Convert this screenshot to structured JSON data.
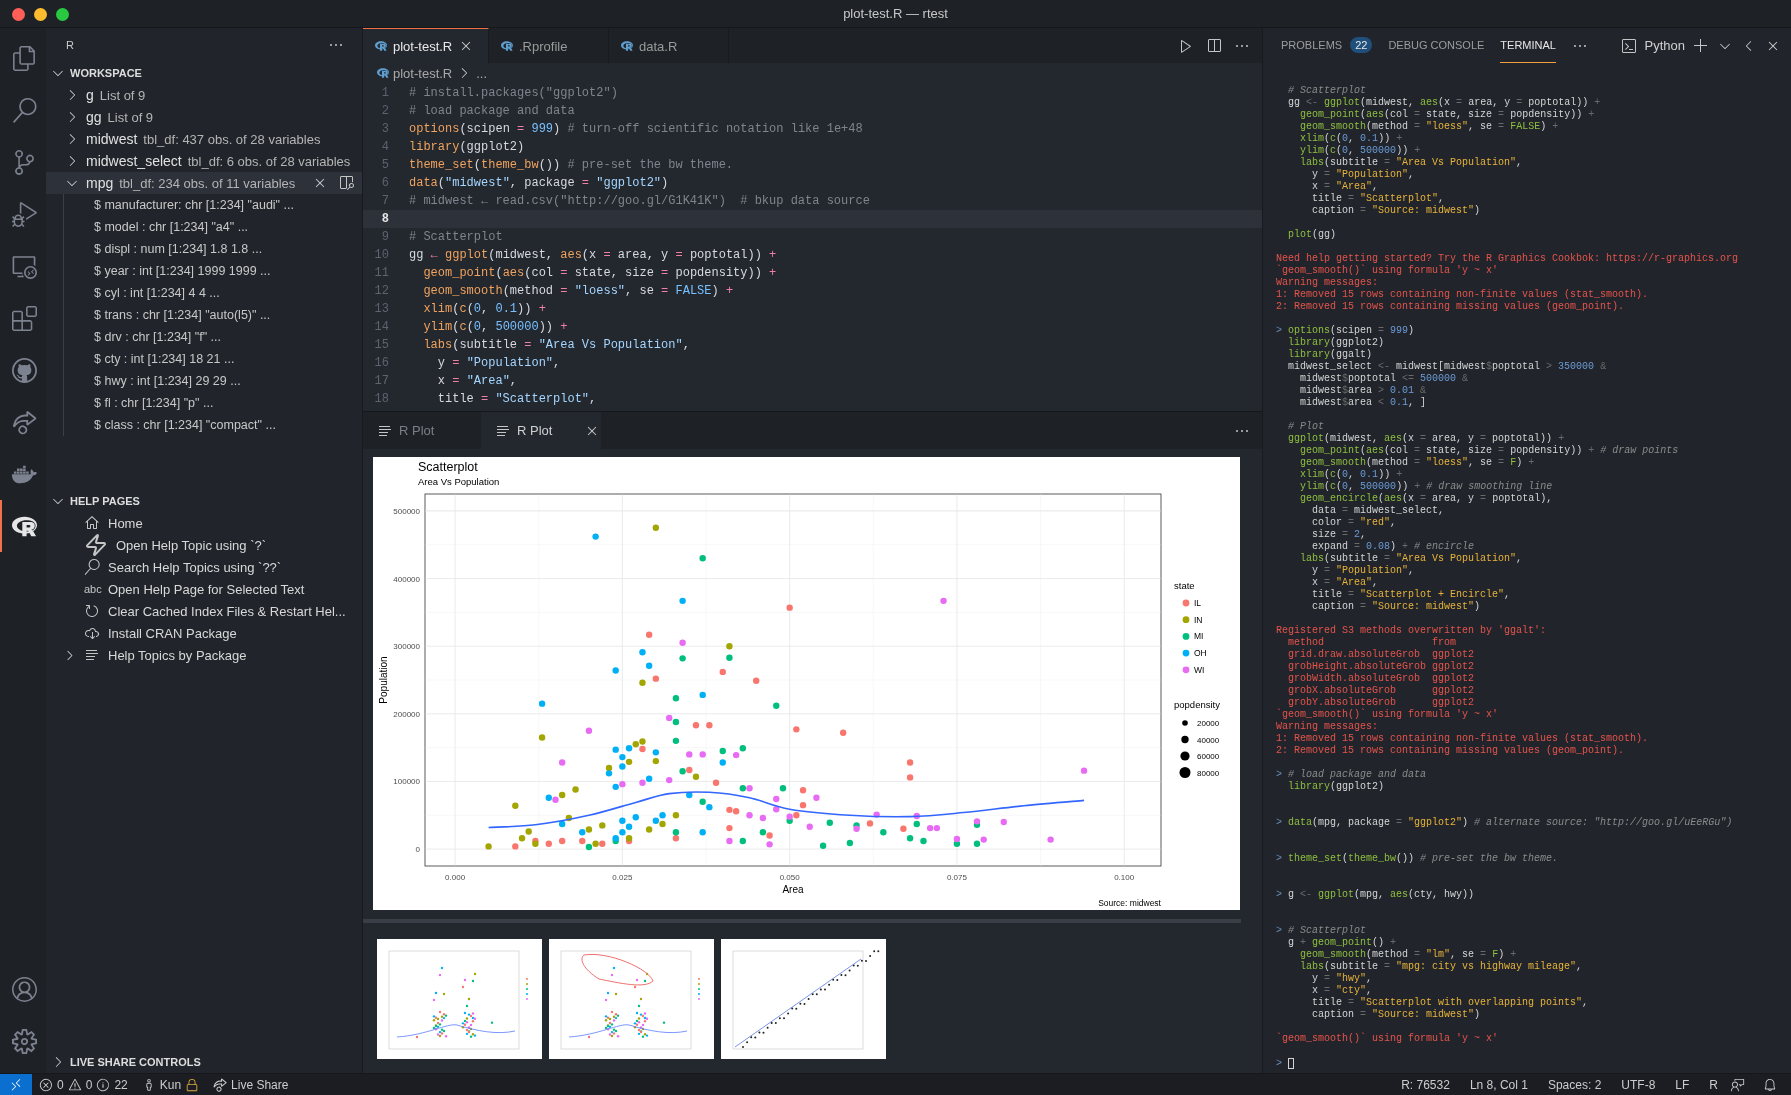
{
  "window": {
    "title": "plot-test.R — rtest"
  },
  "activity_bar": {
    "top": [
      {
        "kind": "files",
        "selected": false
      },
      {
        "kind": "search",
        "selected": false
      },
      {
        "kind": "source-control",
        "selected": false
      },
      {
        "kind": "run-debug",
        "selected": false
      },
      {
        "kind": "remote",
        "selected": false
      },
      {
        "kind": "extensions",
        "selected": false
      },
      {
        "kind": "github",
        "selected": false
      },
      {
        "kind": "live-share",
        "selected": false
      },
      {
        "kind": "docker",
        "selected": false
      },
      {
        "kind": "r",
        "selected": true
      }
    ],
    "bottom": [
      {
        "kind": "account",
        "selected": false
      },
      {
        "kind": "settings",
        "selected": false
      }
    ]
  },
  "sidebar": {
    "title": "R",
    "workspace": {
      "title": "WORKSPACE",
      "expanded": true,
      "items": [
        {
          "name": "g",
          "detail": "List of 9",
          "expanded": false,
          "selected": false
        },
        {
          "name": "gg",
          "detail": "List of 9",
          "expanded": false,
          "selected": false
        },
        {
          "name": "midwest",
          "detail": "tbl_df: 437 obs. of 28 variables",
          "expanded": false,
          "selected": false
        },
        {
          "name": "midwest_select",
          "detail": "tbl_df: 6 obs. of 28 variables",
          "expanded": false,
          "selected": false
        },
        {
          "name": "mpg",
          "detail": "tbl_df: 234 obs. of 11 variables",
          "expanded": true,
          "selected": true,
          "children": [
            {
              "text": "$ manufacturer: chr [1:234] \"audi\" ..."
            },
            {
              "text": "$ model : chr [1:234] \"a4\" ..."
            },
            {
              "text": "$ displ : num [1:234] 1.8 1.8 ..."
            },
            {
              "text": "$ year : int [1:234] 1999 1999 ..."
            },
            {
              "text": "$ cyl : int [1:234] 4 4 ..."
            },
            {
              "text": "$ trans : chr [1:234] \"auto(l5)\" ..."
            },
            {
              "text": "$ drv : chr [1:234] \"f\" ..."
            },
            {
              "text": "$ cty : int [1:234] 18 21 ..."
            },
            {
              "text": "$ hwy : int [1:234] 29 29 ..."
            },
            {
              "text": "$ fl : chr [1:234] \"p\" ..."
            },
            {
              "text": "$ class : chr [1:234] \"compact\" ..."
            }
          ]
        }
      ]
    },
    "help_pages": {
      "title": "HELP PAGES",
      "expanded": true,
      "items": [
        {
          "kind": "home",
          "label": "Home"
        },
        {
          "kind": "zap",
          "label": "Open Help Topic using `?`"
        },
        {
          "kind": "search",
          "label": "Search Help Topics using `??`"
        },
        {
          "kind": "text",
          "icon_text": "abc",
          "label": "Open Help Page for Selected Text"
        },
        {
          "kind": "refresh",
          "label": "Clear Cached Index Files & Restart Hel..."
        },
        {
          "kind": "download",
          "label": "Install CRAN Package"
        },
        {
          "kind": "list",
          "label": "Help Topics by Package",
          "expanded": false
        }
      ]
    },
    "live_share": {
      "title": "LIVE SHARE CONTROLS",
      "expanded": false
    }
  },
  "editor": {
    "tabs": [
      {
        "label": "plot-test.R",
        "selected": true
      },
      {
        "label": ".Rprofile",
        "selected": false
      },
      {
        "label": "data.R",
        "selected": false
      }
    ],
    "breadcrumb": [
      "plot-test.R",
      "..."
    ],
    "lines": [
      {
        "number": "1",
        "text": "# install.packages(\"ggplot2\")",
        "selected": false
      },
      {
        "number": "2",
        "text": "# load package and data",
        "selected": false
      },
      {
        "number": "3",
        "text": "options(scipen = 999) # turn-off scientific notation like 1e+48",
        "selected": false
      },
      {
        "number": "4",
        "text": "library(ggplot2)",
        "selected": false
      },
      {
        "number": "5",
        "text": "theme_set(theme_bw()) # pre-set the bw theme.",
        "selected": false
      },
      {
        "number": "6",
        "text": "data(\"midwest\", package = \"ggplot2\")",
        "selected": false
      },
      {
        "number": "7",
        "text": "# midwest ← read.csv(\"http://goo.gl/G1K41K\")  # bkup data source",
        "selected": false
      },
      {
        "number": "8",
        "selected": true
      },
      {
        "number": "9",
        "text": "# Scatterplot",
        "selected": false
      },
      {
        "number": "10",
        "text": "gg ← ggplot(midwest, aes(x = area, y = poptotal)) +",
        "selected": false
      },
      {
        "number": "11",
        "text": "  geom_point(aes(col = state, size = popdensity)) +",
        "selected": false
      },
      {
        "number": "12",
        "text": "  geom_smooth(method = \"loess\", se = FALSE) +",
        "selected": false
      },
      {
        "number": "13",
        "text": "  xlim(c(0, 0.1)) +",
        "selected": false
      },
      {
        "number": "14",
        "text": "  ylim(c(0, 500000)) +",
        "selected": false
      },
      {
        "number": "15",
        "text": "  labs(subtitle = \"Area Vs Population\",",
        "selected": false
      },
      {
        "number": "16",
        "text": "    y = \"Population\",",
        "selected": false
      },
      {
        "number": "17",
        "text": "    x = \"Area\",",
        "selected": false
      },
      {
        "number": "18",
        "text": "    title = \"Scatterplot\",",
        "selected": false
      }
    ]
  },
  "plot_panel": {
    "tabs": [
      {
        "label": "R Plot",
        "selected": false
      },
      {
        "label": "R Plot",
        "selected": true
      }
    ],
    "chart_subtitle": "Area Vs Population",
    "chart_caption": "Source: midwest",
    "legend_title": "state",
    "size_legend": {
      "title": "popdensity",
      "labels": [
        "20000",
        "40000",
        "60000",
        "80000"
      ]
    },
    "chart_data": {
      "type": "scatter",
      "title": "Scatterplot",
      "grid": true,
      "legend": "right",
      "xlabel": "Area",
      "ylabel": "Population",
      "xlim": [
        -0.0045,
        0.1055
      ],
      "ylim": [
        -25000,
        525000
      ],
      "xticks": [
        {
          "value": 0,
          "label": "0.000"
        },
        {
          "value": 0.025,
          "label": "0.025"
        },
        {
          "value": 0.05,
          "label": "0.050"
        },
        {
          "value": 0.075,
          "label": "0.075"
        },
        {
          "value": 0.1,
          "label": "0.100"
        }
      ],
      "yticks": [
        0,
        100000,
        200000,
        300000,
        400000,
        500000
      ],
      "series": [
        {
          "name": "IL",
          "color": "#f8766d",
          "x": [
            0.029,
            0.03,
            0.04,
            0.05,
            0.045,
            0.036,
            0.038,
            0.051,
            0.058,
            0.068,
            0.068,
            0.052,
            0.052,
            0.028,
            0.035,
            0.039,
            0.041,
            0.042,
            0.062,
            0.067,
            0.009,
            0.012,
            0.014,
            0.019,
            0.022,
            0.026,
            0.033,
            0.041,
            0.047,
            0.051,
            0.016
          ],
          "values": [
            317000,
            252000,
            262000,
            357000,
            249000,
            183000,
            183000,
            177000,
            172000,
            128000,
            106000,
            87000,
            65000,
            148000,
            117000,
            98000,
            58000,
            56000,
            38000,
            30000,
            4000,
            12000,
            8000,
            12000,
            8000,
            12000,
            16000,
            31000,
            20000,
            50000,
            12000
          ]
        },
        {
          "name": "IN",
          "color": "#a3a500",
          "x": [
            0.03,
            0.041,
            0.028,
            0.013,
            0.027,
            0.028,
            0.023,
            0.026,
            0.03,
            0.036,
            0.009,
            0.016,
            0.018,
            0.017,
            0.005,
            0.011,
            0.01,
            0.02,
            0.022,
            0.031,
            0.033,
            0.021,
            0.026,
            0.029,
            0.012
          ],
          "values": [
            475000,
            300000,
            246000,
            165000,
            155000,
            159000,
            120000,
            129000,
            130000,
            107000,
            64000,
            80000,
            88000,
            46000,
            4000,
            26000,
            16000,
            29000,
            35000,
            37000,
            50000,
            8000,
            16000,
            29000,
            8000
          ]
        },
        {
          "name": "MI",
          "color": "#00bf7d",
          "x": [
            0.037,
            0.034,
            0.041,
            0.033,
            0.033,
            0.048,
            0.033,
            0.04,
            0.043,
            0.034,
            0.043,
            0.049,
            0.037,
            0.046,
            0.064,
            0.069,
            0.078,
            0.06,
            0.075,
            0.078,
            0.07,
            0.068,
            0.055,
            0.05,
            0.056,
            0.02,
            0.024,
            0.033,
            0.043,
            0.059
          ],
          "values": [
            430000,
            282000,
            283000,
            223000,
            188000,
            212000,
            160000,
            145000,
            149000,
            115000,
            90000,
            90000,
            70000,
            25000,
            25000,
            37000,
            36000,
            35000,
            8000,
            8000,
            12000,
            16000,
            5000,
            42000,
            39000,
            3000,
            12000,
            25000,
            12000,
            9000
          ]
        },
        {
          "name": "OH",
          "color": "#00b0f6",
          "x": [
            0.021,
            0.034,
            0.028,
            0.029,
            0.024,
            0.037,
            0.013,
            0.014,
            0.024,
            0.026,
            0.03,
            0.025,
            0.025,
            0.023,
            0.029,
            0.035,
            0.024,
            0.04,
            0.038,
            0.027,
            0.025,
            0.025,
            0.024,
            0.026,
            0.03,
            0.031,
            0.016,
            0.019,
            0.037
          ],
          "values": [
            462000,
            367000,
            291000,
            271000,
            264000,
            228000,
            215000,
            76000,
            147000,
            149000,
            143000,
            136000,
            122000,
            112000,
            104000,
            80000,
            92000,
            128000,
            62000,
            47000,
            42000,
            25000,
            16000,
            33000,
            42000,
            50000,
            37000,
            25000,
            25000
          ]
        },
        {
          "name": "WI",
          "color": "#e76bf3",
          "x": [
            0.073,
            0.034,
            0.032,
            0.02,
            0.016,
            0.035,
            0.037,
            0.042,
            0.025,
            0.028,
            0.032,
            0.015,
            0.044,
            0.048,
            0.048,
            0.054,
            0.044,
            0.046,
            0.05,
            0.063,
            0.069,
            0.071,
            0.072,
            0.078,
            0.082,
            0.094,
            0.089,
            0.075,
            0.079,
            0.06,
            0.053,
            0.047,
            0.041
          ],
          "values": [
            367000,
            305000,
            194000,
            175000,
            128000,
            140000,
            140000,
            139000,
            96000,
            98000,
            102000,
            73000,
            90000,
            74000,
            59000,
            76000,
            50000,
            46000,
            48000,
            51000,
            49000,
            31000,
            31000,
            41000,
            40000,
            116000,
            14000,
            15000,
            14000,
            30000,
            33000,
            7000,
            12000
          ]
        },
        {
          "type": "line",
          "color": "#3366ff",
          "x": [
            0.005,
            0.012,
            0.02,
            0.027,
            0.032,
            0.038,
            0.044,
            0.05,
            0.059,
            0.068,
            0.076,
            0.085,
            0.094
          ],
          "values": [
            32000,
            36000,
            50000,
            69000,
            82000,
            84000,
            76000,
            59000,
            50000,
            48000,
            54000,
            64000,
            72000
          ]
        }
      ]
    },
    "thumbnails": [
      {
        "kind": "scatter",
        "selected": false
      },
      {
        "kind": "encircle",
        "selected": false
      },
      {
        "kind": "regression",
        "selected": false
      }
    ]
  },
  "terminal_panel": {
    "tabs": [
      {
        "label": "PROBLEMS",
        "badge": "22",
        "selected": false
      },
      {
        "label": "DEBUG CONSOLE",
        "selected": false
      },
      {
        "label": "TERMINAL",
        "selected": true
      }
    ],
    "shell": "Python",
    "lines": [
      {
        "kind": "code",
        "text": "# Scatterplot"
      },
      {
        "kind": "code",
        "text": "gg <- ggplot(midwest, aes(x = area, y = poptotal)) +"
      },
      {
        "kind": "code",
        "text": "  geom_point(aes(col = state, size = popdensity)) +"
      },
      {
        "kind": "code",
        "text": "  geom_smooth(method = \"loess\", se = FALSE) +"
      },
      {
        "kind": "code",
        "text": "  xlim(c(0, 0.1)) +"
      },
      {
        "kind": "code",
        "text": "  ylim(c(0, 500000)) +"
      },
      {
        "kind": "code",
        "text": "  labs(subtitle = \"Area Vs Population\","
      },
      {
        "kind": "code",
        "text": "    y = \"Population\","
      },
      {
        "kind": "code",
        "text": "    x = \"Area\","
      },
      {
        "kind": "code",
        "text": "    title = \"Scatterplot\","
      },
      {
        "kind": "code",
        "text": "    caption = \"Source: midwest\")"
      },
      {
        "kind": "blank"
      },
      {
        "kind": "code",
        "text": "plot(gg)"
      },
      {
        "kind": "blank"
      },
      {
        "kind": "error",
        "text": "Need help getting started? Try the R Graphics Cookbok: https://r-graphics.org"
      },
      {
        "kind": "error",
        "text": "`geom_smooth()` using formula 'y ~ x'"
      },
      {
        "kind": "error",
        "text": "Warning messages:"
      },
      {
        "kind": "error",
        "text": "1: Removed 15 rows containing non-finite values (stat_smooth)."
      },
      {
        "kind": "error",
        "text": "2: Removed 15 rows containing missing values (geom_point)."
      },
      {
        "kind": "blank"
      },
      {
        "kind": "code",
        "prompt": ">",
        "text": "options(scipen = 999)"
      },
      {
        "kind": "code",
        "text": "library(ggplot2)"
      },
      {
        "kind": "code",
        "text": "library(ggalt)"
      },
      {
        "kind": "code",
        "text": "midwest_select <- midwest[midwest$poptotal > 350000 &"
      },
      {
        "kind": "code",
        "text": "  midwest$poptotal <= 500000 &"
      },
      {
        "kind": "code",
        "text": "  midwest$area > 0.01 &"
      },
      {
        "kind": "code",
        "text": "  midwest$area < 0.1, ]"
      },
      {
        "kind": "blank"
      },
      {
        "kind": "code",
        "text": "# Plot"
      },
      {
        "kind": "code",
        "text": "ggplot(midwest, aes(x = area, y = poptotal)) +"
      },
      {
        "kind": "code",
        "text": "  geom_point(aes(col = state, size = popdensity)) + # draw points"
      },
      {
        "kind": "code",
        "text": "  geom_smooth(method = \"loess\", se = F) +"
      },
      {
        "kind": "code",
        "text": "  xlim(c(0, 0.1)) +"
      },
      {
        "kind": "code",
        "text": "  ylim(c(0, 500000)) + # draw smoothing line"
      },
      {
        "kind": "code",
        "text": "  geom_encircle(aes(x = area, y = poptotal),"
      },
      {
        "kind": "code",
        "text": "    data = midwest_select,"
      },
      {
        "kind": "code",
        "text": "    color = \"red\","
      },
      {
        "kind": "code",
        "text": "    size = 2,"
      },
      {
        "kind": "code",
        "text": "    expand = 0.08) + # encircle"
      },
      {
        "kind": "code",
        "text": "  labs(subtitle = \"Area Vs Population\","
      },
      {
        "kind": "code",
        "text": "    y = \"Population\","
      },
      {
        "kind": "code",
        "text": "    x = \"Area\","
      },
      {
        "kind": "code",
        "text": "    title = \"Scatterplot + Encircle\","
      },
      {
        "kind": "code",
        "text": "    caption = \"Source: midwest\")"
      },
      {
        "kind": "blank"
      },
      {
        "kind": "error",
        "text": "Registered S3 methods overwritten by 'ggalt':"
      },
      {
        "kind": "error",
        "text": "  method                  from"
      },
      {
        "kind": "error",
        "text": "  grid.draw.absoluteGrob  ggplot2"
      },
      {
        "kind": "error",
        "text": "  grobHeight.absoluteGrob ggplot2"
      },
      {
        "kind": "error",
        "text": "  grobWidth.absoluteGrob  ggplot2"
      },
      {
        "kind": "error",
        "text": "  grobX.absoluteGrob      ggplot2"
      },
      {
        "kind": "error",
        "text": "  grobY.absoluteGrob      ggplot2"
      },
      {
        "kind": "error",
        "text": "`geom_smooth()` using formula 'y ~ x'"
      },
      {
        "kind": "error",
        "text": "Warning messages:"
      },
      {
        "kind": "error",
        "text": "1: Removed 15 rows containing non-finite values (stat_smooth)."
      },
      {
        "kind": "error",
        "text": "2: Removed 15 rows containing missing values (geom_point)."
      },
      {
        "kind": "blank"
      },
      {
        "kind": "code",
        "prompt": ">",
        "text": "# load package and data"
      },
      {
        "kind": "code",
        "text": "library(ggplot2)"
      },
      {
        "kind": "blank"
      },
      {
        "kind": "blank"
      },
      {
        "kind": "code",
        "prompt": ">",
        "text": "data(mpg, package = \"ggplot2\") # alternate source: \"http://goo.gl/uEeRGu\")"
      },
      {
        "kind": "blank"
      },
      {
        "kind": "blank"
      },
      {
        "kind": "code",
        "prompt": ">",
        "text": "theme_set(theme_bw()) # pre-set the bw theme."
      },
      {
        "kind": "blank"
      },
      {
        "kind": "blank"
      },
      {
        "kind": "code",
        "prompt": ">",
        "text": "g <- ggplot(mpg, aes(cty, hwy))"
      },
      {
        "kind": "blank"
      },
      {
        "kind": "blank"
      },
      {
        "kind": "code",
        "prompt": ">",
        "text": "# Scatterplot"
      },
      {
        "kind": "code",
        "text": "g + geom_point() +"
      },
      {
        "kind": "code",
        "text": "  geom_smooth(method = \"lm\", se = F) +"
      },
      {
        "kind": "code",
        "text": "  labs(subtitle = \"mpg: city vs highway mileage\","
      },
      {
        "kind": "code",
        "text": "    y = \"hwy\","
      },
      {
        "kind": "code",
        "text": "    x = \"cty\","
      },
      {
        "kind": "code",
        "text": "    title = \"Scatterplot with overlapping points\","
      },
      {
        "kind": "code",
        "text": "    caption = \"Source: midwest\")"
      },
      {
        "kind": "blank"
      },
      {
        "kind": "error",
        "text": "`geom_smooth()` using formula 'y ~ x'"
      },
      {
        "kind": "blank"
      },
      {
        "kind": "cursor",
        "prompt": ">"
      }
    ]
  },
  "status_bar": {
    "errors": "0",
    "warnings": "0",
    "info": "22",
    "user": "Kun",
    "live_share": "Live Share",
    "right": [
      "R: 76532",
      "Ln 8, Col 1",
      "Spaces: 2",
      "UTF-8",
      "LF",
      "R"
    ]
  }
}
